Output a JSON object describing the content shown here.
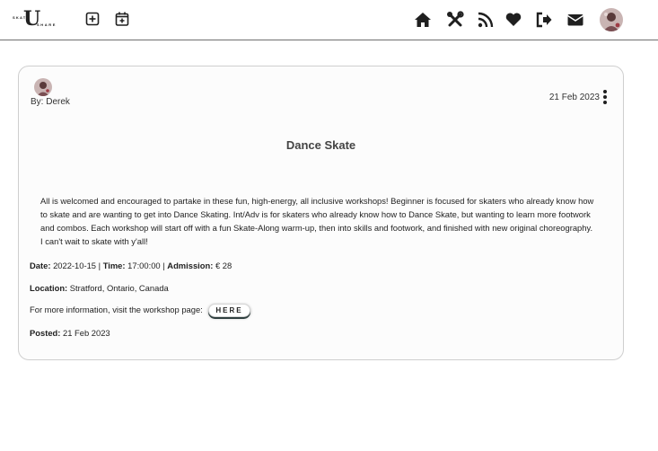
{
  "nav": {
    "logo_letter": "U",
    "logo_top": "SKATE",
    "logo_bottom": "SHARE",
    "left_icons": [
      "add-post-icon",
      "add-event-icon"
    ],
    "right_icons": [
      "home-icon",
      "tools-icon",
      "rss-feed-icon",
      "heart-icon",
      "sign-out-icon",
      "envelope-icon"
    ],
    "avatar": "user-avatar"
  },
  "post": {
    "author": "By: Derek",
    "date": "21 Feb 2023",
    "title": "Dance Skate",
    "description": "All is welcomed and encouraged to partake in these fun, high-energy, all inclusive workshops! Beginner is focused for skaters who already know how to skate and are wanting to get into Dance Skating. Int/Adv is for skaters who already know how to Dance Skate, but wanting to learn more footwork and combos. Each workshop will start off with a fun Skate-Along warm-up, then into skills and footwork, and finished with new original choreography. I can't wait to skate with y'all!",
    "date_label": "Date:",
    "date_value": "2022-10-15",
    "sep1": "|",
    "time_label": "Time:",
    "time_value": "17:00:00",
    "sep2": "|",
    "admission_label": "Admission:",
    "admission_value": "€ 28",
    "location_label": "Location:",
    "location_value": "Stratford, Ontario, Canada",
    "more_info_text": "For more information, visit the workshop page:",
    "here_label": "HERE",
    "posted_label": "Posted:",
    "posted_value": "21 Feb 2023"
  },
  "colors": {
    "icon": "#1f1f1f",
    "card_border": "#cfcfcf",
    "button_shadow": "#2f3f3f"
  }
}
